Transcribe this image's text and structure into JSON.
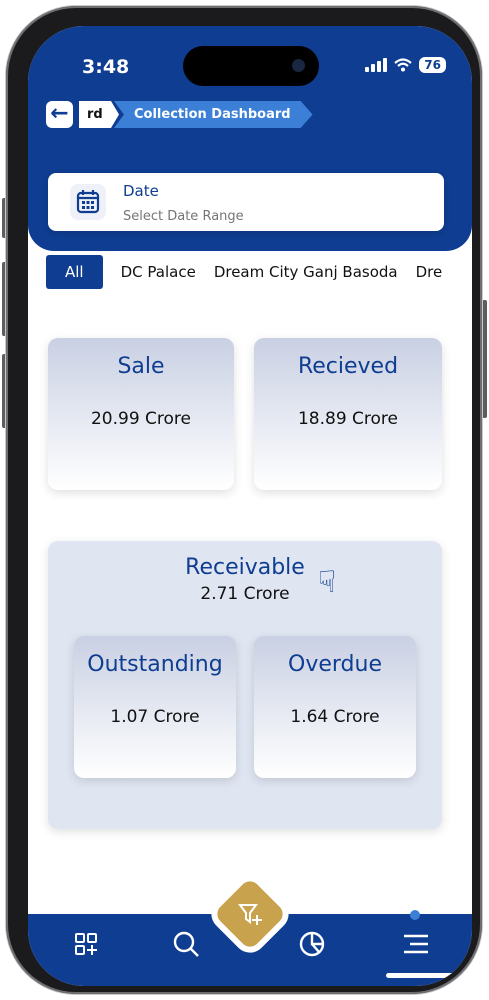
{
  "status_bar": {
    "time": "3:48",
    "battery": "76"
  },
  "breadcrumb": {
    "prev": "rd",
    "current": "Collection Dashboard"
  },
  "date_filter": {
    "label": "Date",
    "placeholder": "Select Date Range"
  },
  "tabs": [
    "All",
    "DC Palace",
    "Dream City Ganj Basoda",
    "Dre"
  ],
  "cards": {
    "sale": {
      "title": "Sale",
      "value": "20.99 Crore"
    },
    "received": {
      "title": "Recieved",
      "value": "18.89 Crore"
    }
  },
  "receivable": {
    "title": "Receivable",
    "value": "2.71 Crore",
    "outstanding": {
      "title": "Outstanding",
      "value": "1.07 Crore"
    },
    "overdue": {
      "title": "Overdue",
      "value": "1.64 Crore"
    }
  },
  "nav": {
    "icons": [
      "grid-plus-icon",
      "search-icon",
      "filter-plus-icon",
      "pie-chart-icon",
      "menu-icon"
    ]
  },
  "colors": {
    "primary": "#0e3d91",
    "accent": "#3b7fd6",
    "gold": "#c8a24d"
  }
}
